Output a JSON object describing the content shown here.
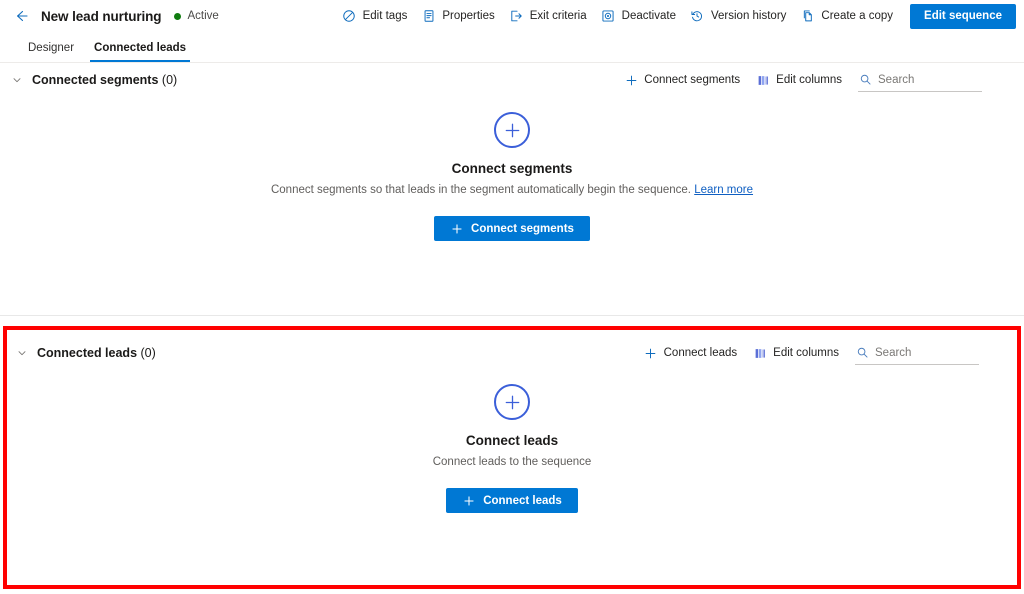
{
  "commandbar": {
    "back_icon": "back-arrow-icon",
    "title": "New lead nurturing",
    "status": "Active",
    "status_color": "#107c10",
    "actions": [
      {
        "label": "Edit tags",
        "icon": "tag-icon"
      },
      {
        "label": "Properties",
        "icon": "properties-icon"
      },
      {
        "label": "Exit criteria",
        "icon": "exit-icon"
      },
      {
        "label": "Deactivate",
        "icon": "deactivate-icon"
      },
      {
        "label": "Version history",
        "icon": "history-icon"
      },
      {
        "label": "Create a copy",
        "icon": "copy-icon"
      }
    ],
    "primary_button": "Edit sequence",
    "accent_color": "#0078d4"
  },
  "tabs": [
    {
      "label": "Designer",
      "active": false
    },
    {
      "label": "Connected leads",
      "active": true
    }
  ],
  "segments_section": {
    "title": "Connected segments",
    "count": "(0)",
    "chevron_icon": "chevron-down-icon",
    "connect_button": "Connect segments",
    "connect_icon": "plus-icon",
    "edit_columns_button": "Edit columns",
    "edit_columns_icon": "edit-columns-icon",
    "search_placeholder": "Search",
    "search_value": "",
    "search_icon": "search-icon",
    "empty": {
      "icon": "plus-circle-icon",
      "title": "Connect segments",
      "description": "Connect segments so that leads in the segment automatically begin the sequence.",
      "link": "Learn more",
      "button": "Connect segments"
    }
  },
  "leads_section": {
    "title": "Connected leads",
    "count": "(0)",
    "chevron_icon": "chevron-down-icon",
    "connect_button": "Connect leads",
    "connect_icon": "plus-icon",
    "edit_columns_button": "Edit columns",
    "edit_columns_icon": "edit-columns-icon",
    "search_placeholder": "Search",
    "search_value": "",
    "search_icon": "search-icon",
    "highlight_color": "#ff0000",
    "empty": {
      "icon": "plus-circle-icon",
      "title": "Connect leads",
      "description": "Connect leads to the sequence",
      "button": "Connect leads"
    }
  }
}
